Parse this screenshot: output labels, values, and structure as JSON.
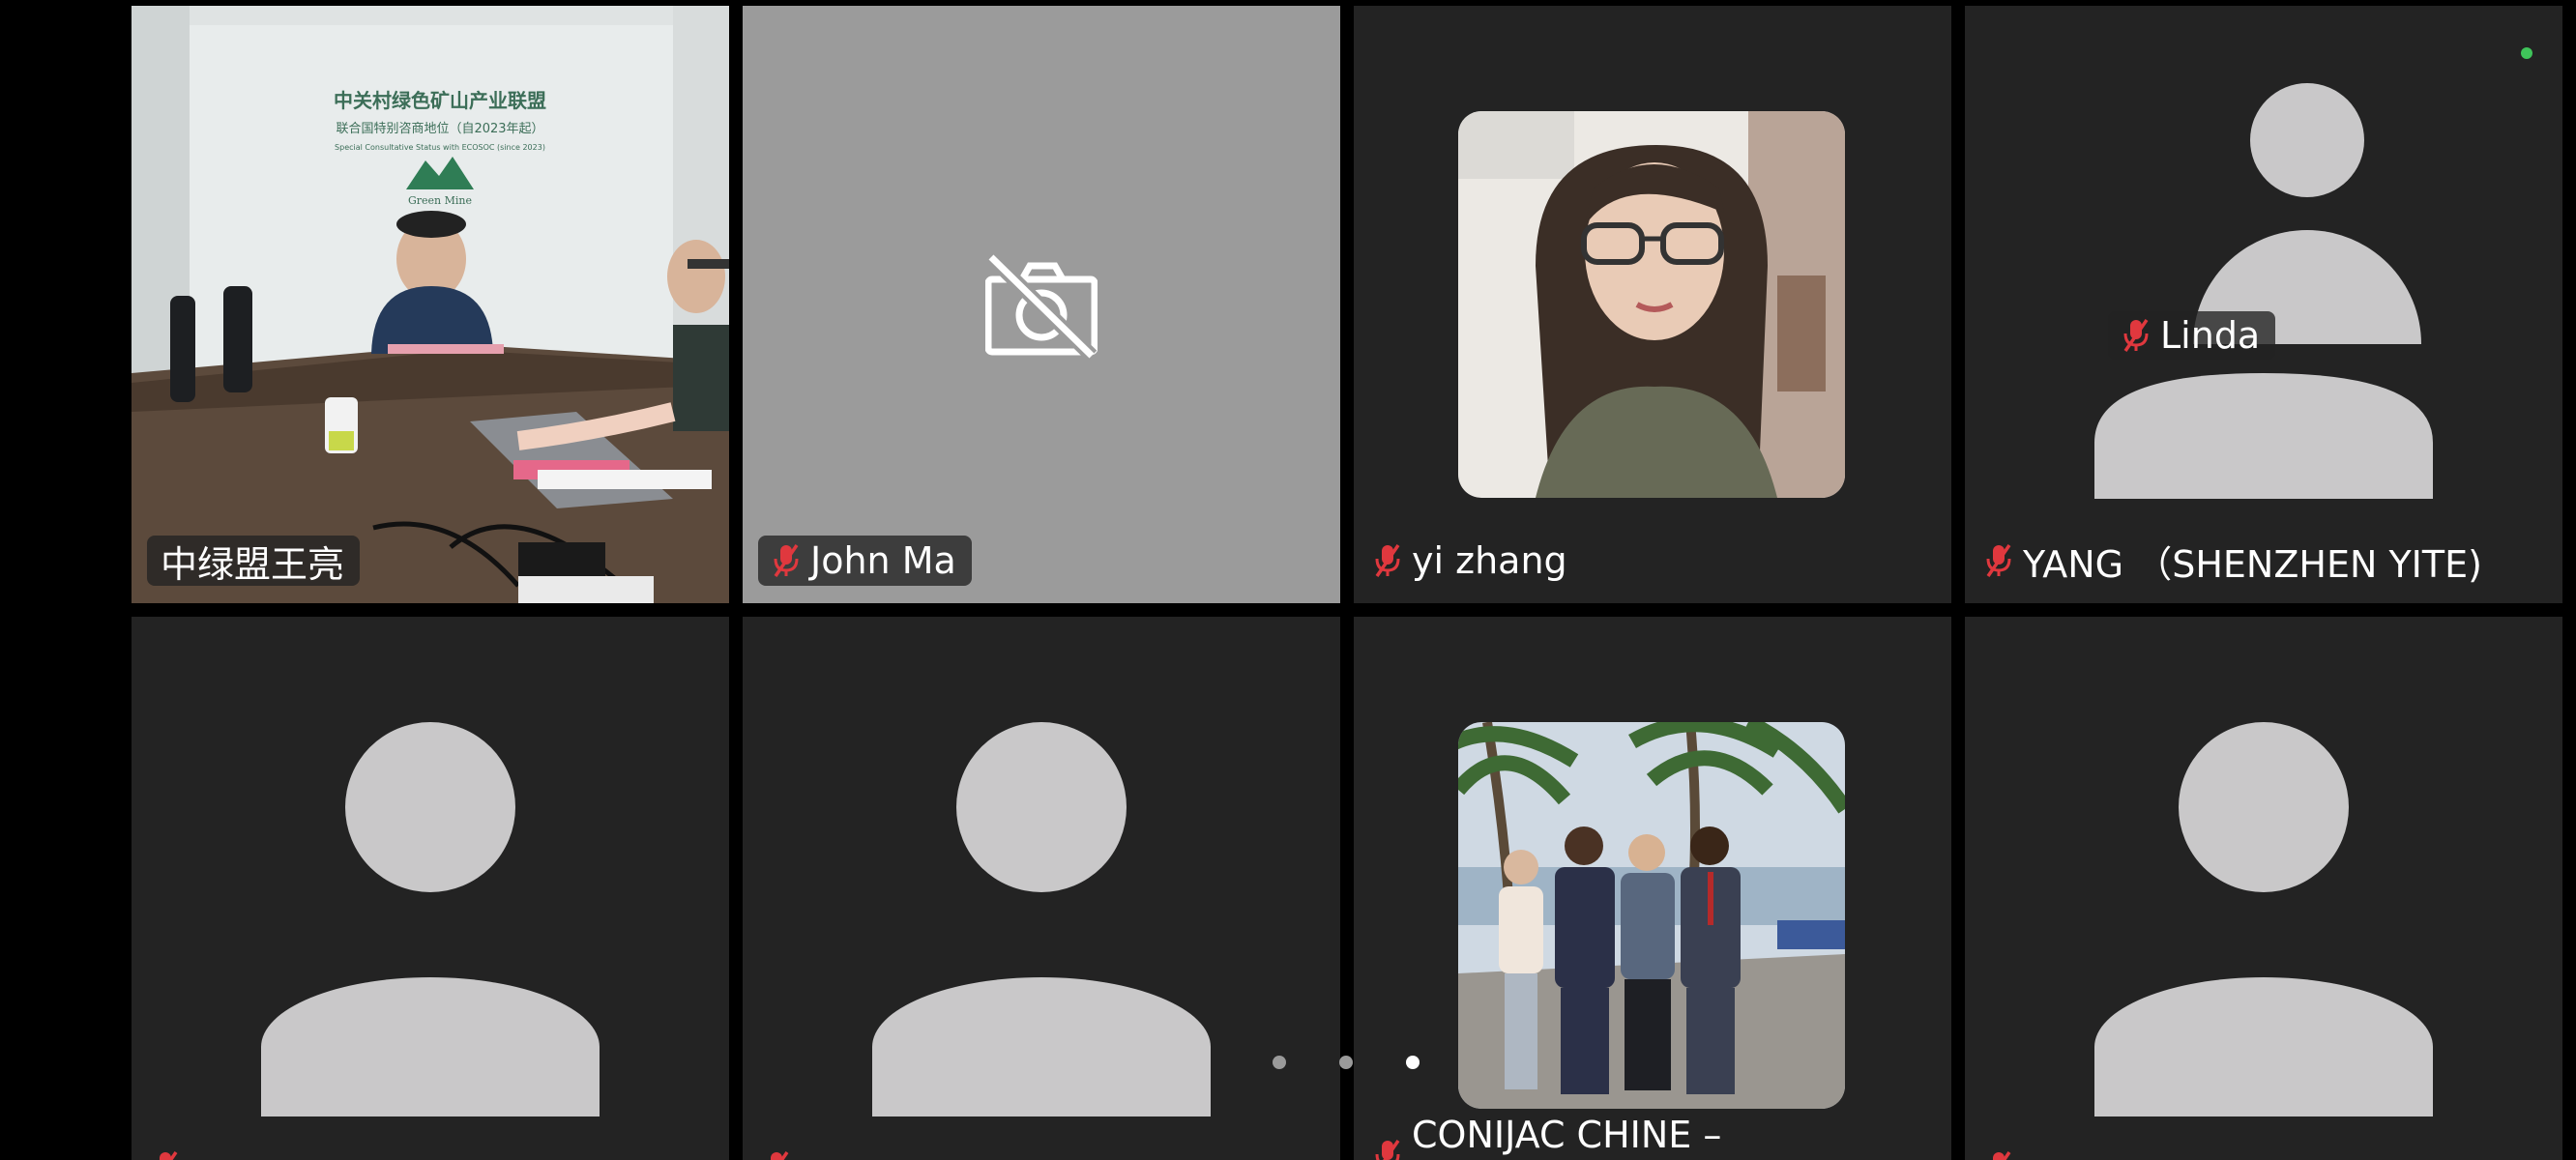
{
  "participants": [
    {
      "name": "中绿盟王亮",
      "mic": "on",
      "video": "on"
    },
    {
      "name": "John Ma",
      "mic": "muted",
      "video": "off"
    },
    {
      "name": "yi zhang",
      "mic": "muted",
      "video": "photo"
    },
    {
      "name": "YANG （SHENZHEN YITE)",
      "mic": "muted",
      "video": "avatar"
    },
    {
      "name": "",
      "mic": "muted",
      "video": "avatar"
    },
    {
      "name": "",
      "mic": "muted",
      "video": "avatar"
    },
    {
      "name": "CONIJAC CHINE –",
      "mic": "muted",
      "video": "photo"
    },
    {
      "name": "",
      "mic": "muted",
      "video": "avatar"
    }
  ],
  "floating_label": {
    "name": "Linda",
    "mic": "muted"
  },
  "scene_text": {
    "wall_line1": "中关村绿色矿山产业联盟",
    "wall_line2": "联合国特别咨商地位（自2023年起）",
    "wall_line3": "Special Consultative Status with ECOSOC (since 2023)",
    "logo": "Green Mine"
  },
  "pagination": {
    "pages": 3,
    "current": 3
  },
  "colors": {
    "tile_bg": "#232323",
    "video_off_bg": "#9b9b9b",
    "mute_red": "#e0383e",
    "active_green": "#3fc45a",
    "avatar": "#c9c8c9"
  }
}
